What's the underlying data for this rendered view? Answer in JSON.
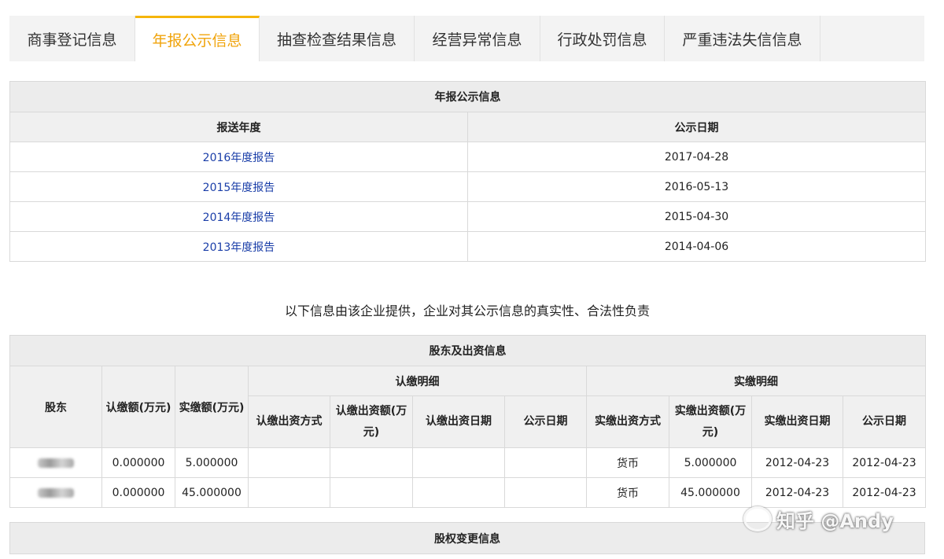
{
  "tabs": [
    {
      "label": "商事登记信息",
      "active": false
    },
    {
      "label": "年报公示信息",
      "active": true
    },
    {
      "label": "抽查检查结果信息",
      "active": false
    },
    {
      "label": "经营异常信息",
      "active": false
    },
    {
      "label": "行政处罚信息",
      "active": false
    },
    {
      "label": "严重违法失信信息",
      "active": false
    }
  ],
  "annual": {
    "title": "年报公示信息",
    "headers": [
      "报送年度",
      "公示日期"
    ],
    "rows": [
      {
        "report": "2016年度报告",
        "date": "2017-04-28"
      },
      {
        "report": "2015年度报告",
        "date": "2016-05-13"
      },
      {
        "report": "2014年度报告",
        "date": "2015-04-30"
      },
      {
        "report": "2013年度报告",
        "date": "2014-04-06"
      }
    ]
  },
  "notice": "以下信息由该企业提供，企业对其公示信息的真实性、合法性负责",
  "shareholders": {
    "title": "股东及出资信息",
    "col_shareholder": "股东",
    "col_subscribed": "认缴额(万元)",
    "col_paid": "实缴额(万元)",
    "group_subscribed": "认缴明细",
    "group_paid": "实缴明细",
    "sub_headers": [
      "认缴出资方式",
      "认缴出资额(万元)",
      "认缴出资日期",
      "公示日期"
    ],
    "paid_headers": [
      "实缴出资方式",
      "实缴出资额(万元)",
      "实缴出资日期",
      "公示日期"
    ],
    "rows": [
      {
        "subscribed": "0.000000",
        "paid": "5.000000",
        "sub_method": "",
        "sub_amount": "",
        "sub_date": "",
        "sub_pub": "",
        "paid_method": "货币",
        "paid_amount": "5.000000",
        "paid_date": "2012-04-23",
        "paid_pub": "2012-04-23"
      },
      {
        "subscribed": "0.000000",
        "paid": "45.000000",
        "sub_method": "",
        "sub_amount": "",
        "sub_date": "",
        "sub_pub": "",
        "paid_method": "货币",
        "paid_amount": "45.000000",
        "paid_date": "2012-04-23",
        "paid_pub": "2012-04-23"
      }
    ]
  },
  "equity_change": {
    "title": "股权变更信息"
  },
  "watermark": "知乎 @Andy"
}
